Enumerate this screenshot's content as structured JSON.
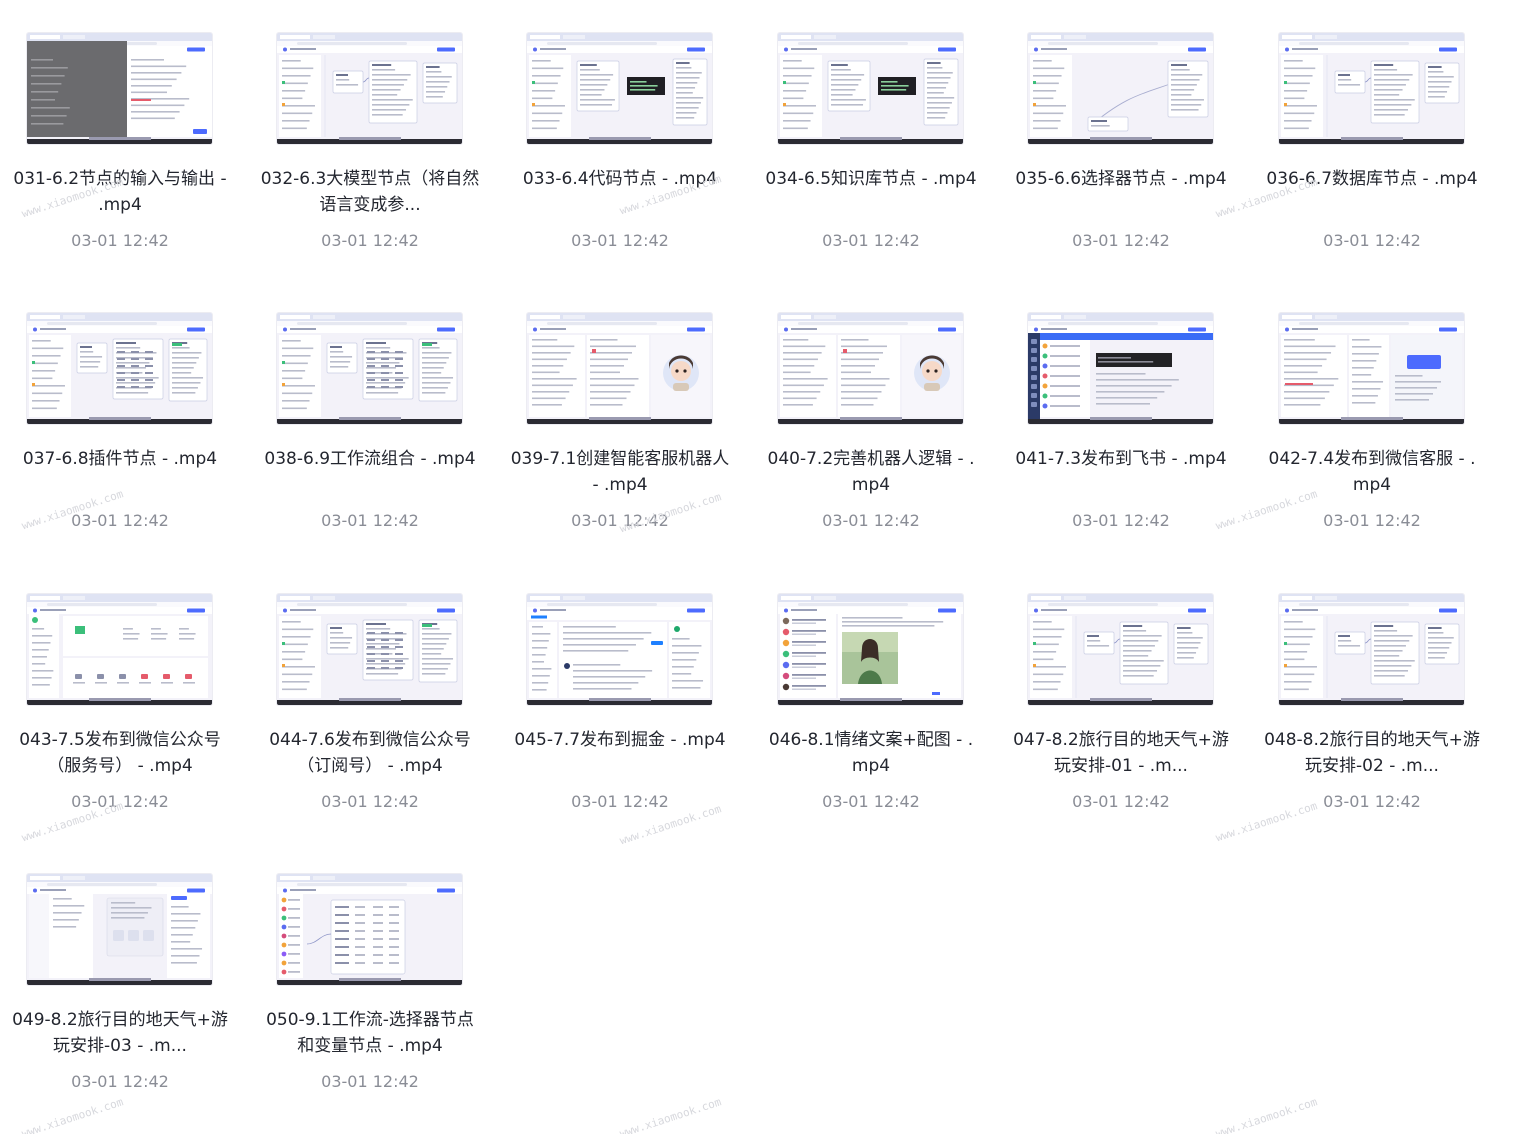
{
  "watermark": "www.xiaomook.com",
  "files": [
    {
      "name": "031-6.2节点的输入与输出 - .mp4",
      "date": "03-01 12:42",
      "thumb": "dark-overlay"
    },
    {
      "name": "032-6.3大模型节点（将自然语言变成参...",
      "date": "03-01 12:42",
      "thumb": "workflow"
    },
    {
      "name": "033-6.4代码节点 - .mp4",
      "date": "03-01 12:42",
      "thumb": "workflow-code"
    },
    {
      "name": "034-6.5知识库节点 - .mp4",
      "date": "03-01 12:42",
      "thumb": "workflow-code"
    },
    {
      "name": "035-6.6选择器节点 - .mp4",
      "date": "03-01 12:42",
      "thumb": "workflow-curve"
    },
    {
      "name": "036-6.7数据库节点 - .mp4",
      "date": "03-01 12:42",
      "thumb": "workflow"
    },
    {
      "name": "037-6.8插件节点 - .mp4",
      "date": "03-01 12:42",
      "thumb": "workflow-table"
    },
    {
      "name": "038-6.9工作流组合 - .mp4",
      "date": "03-01 12:42",
      "thumb": "workflow-table"
    },
    {
      "name": "039-7.1创建智能客服机器人 - .mp4",
      "date": "03-01 12:42",
      "thumb": "bot-avatar"
    },
    {
      "name": "040-7.2完善机器人逻辑 - .mp4",
      "date": "03-01 12:42",
      "thumb": "bot-avatar"
    },
    {
      "name": "041-7.3发布到飞书 - .mp4",
      "date": "03-01 12:42",
      "thumb": "feishu"
    },
    {
      "name": "042-7.4发布到微信客服 - .mp4",
      "date": "03-01 12:42",
      "thumb": "chat-blue"
    },
    {
      "name": "043-7.5发布到微信公众号（服务号） - .mp4",
      "date": "03-01 12:42",
      "thumb": "dashboard"
    },
    {
      "name": "044-7.6发布到微信公众号（订阅号） - .mp4",
      "date": "03-01 12:42",
      "thumb": "workflow-table"
    },
    {
      "name": "045-7.7发布到掘金 - .mp4",
      "date": "03-01 12:42",
      "thumb": "juejin"
    },
    {
      "name": "046-8.1情绪文案+配图 - .mp4",
      "date": "03-01 12:42",
      "thumb": "photo"
    },
    {
      "name": "047-8.2旅行目的地天气+游玩安排-01 - .m...",
      "date": "03-01 12:42",
      "thumb": "workflow"
    },
    {
      "name": "048-8.2旅行目的地天气+游玩安排-02 - .m...",
      "date": "03-01 12:42",
      "thumb": "workflow"
    },
    {
      "name": "049-8.2旅行目的地天气+游玩安排-03 - .m...",
      "date": "03-01 12:42",
      "thumb": "form"
    },
    {
      "name": "050-9.1工作流-选择器节点和变量节点 - .mp4",
      "date": "03-01 12:42",
      "thumb": "nodes-list"
    }
  ]
}
